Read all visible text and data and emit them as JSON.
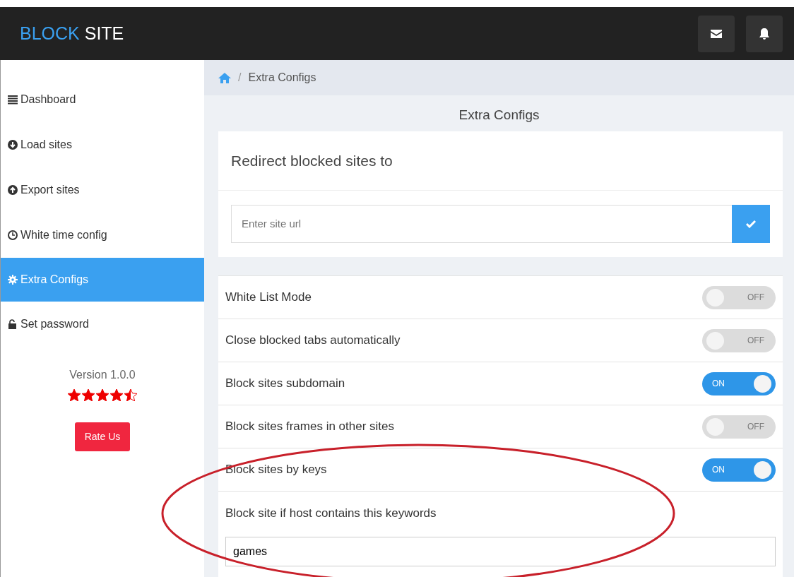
{
  "header": {
    "brand_part_1": "BLOCK",
    "brand_part_2": "SITE"
  },
  "sidebar": {
    "items": [
      {
        "label": "Dashboard",
        "selected": false
      },
      {
        "label": "Load sites",
        "selected": false
      },
      {
        "label": "Export sites",
        "selected": false
      },
      {
        "label": "White time config",
        "selected": false
      },
      {
        "label": "Extra Configs",
        "selected": true
      },
      {
        "label": "Set password",
        "selected": false
      }
    ],
    "version": "Version 1.0.0",
    "stars": 4.5,
    "rate_button": "Rate Us"
  },
  "breadcrumb": {
    "separator": "/",
    "current": "Extra Configs"
  },
  "page_title": "Extra Configs",
  "redirect_card": {
    "title": "Redirect blocked sites to",
    "placeholder": "Enter site url"
  },
  "settings": [
    {
      "label": "White List Mode",
      "on": false,
      "state_label": "OFF"
    },
    {
      "label": "Close blocked tabs automatically",
      "on": false,
      "state_label": "OFF"
    },
    {
      "label": "Block sites subdomain",
      "on": true,
      "state_label": "ON"
    },
    {
      "label": "Block sites frames in other sites",
      "on": false,
      "state_label": "OFF"
    },
    {
      "label": "Block sites by keys",
      "on": true,
      "state_label": "ON"
    }
  ],
  "keywords": {
    "label": "Block site if host contains this keywords",
    "value": "games"
  }
}
